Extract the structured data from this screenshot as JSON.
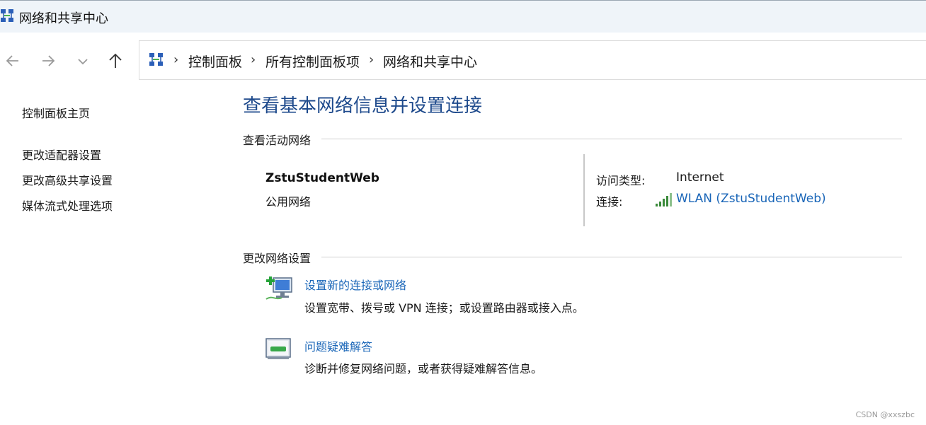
{
  "window": {
    "title": "网络和共享中心"
  },
  "nav": {
    "back": "←",
    "forward": "→",
    "recent": "⌄",
    "up": "↑"
  },
  "breadcrumb": [
    "控制面板",
    "所有控制面板项",
    "网络和共享中心"
  ],
  "breadcrumb_sep": "›",
  "sidebar": {
    "home": "控制面板主页",
    "items": [
      "更改适配器设置",
      "更改高级共享设置",
      "媒体流式处理选项"
    ]
  },
  "main": {
    "title": "查看基本网络信息并设置连接",
    "active_section": "查看活动网络",
    "network": {
      "name": "ZstuStudentWeb",
      "category": "公用网络",
      "access_label": "访问类型:",
      "access_value": "Internet",
      "connection_label": "连接:",
      "connection_value": "WLAN (ZstuStudentWeb)"
    },
    "change_section": "更改网络设置",
    "tasks": [
      {
        "link": "设置新的连接或网络",
        "desc": "设置宽带、拨号或 VPN 连接；或设置路由器或接入点。",
        "icon": "new-connection-icon"
      },
      {
        "link": "问题疑难解答",
        "desc": "诊断并修复网络问题，或者获得疑难解答信息。",
        "icon": "troubleshoot-icon"
      }
    ]
  },
  "watermark": "CSDN @xxszbc",
  "colors": {
    "accent": "#1e4a8c",
    "link": "#1a66b8",
    "titlebar": "#eff4f9"
  }
}
